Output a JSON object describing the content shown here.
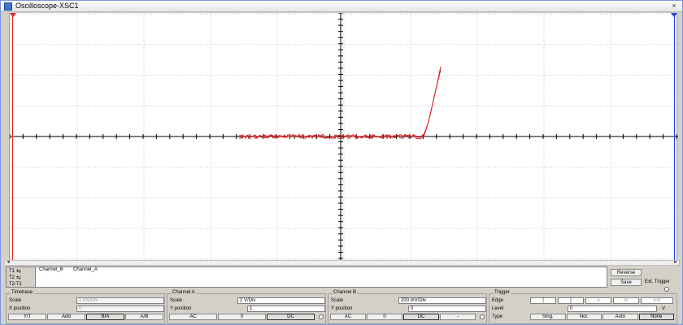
{
  "window": {
    "title": "Oscilloscope-XSC1",
    "close_glyph": "×"
  },
  "scope": {
    "grid": true,
    "trace_color": "#e02020",
    "cursor1_color": "#e02020",
    "cursor2_color": "#2040e0"
  },
  "readout": {
    "t1": "T1",
    "t2": "T2",
    "t2t1": "T2-T1",
    "arrow_glyph": "⇆",
    "col_channel_b": "Channel_B",
    "col_channel_a": "Channel_A",
    "reverse_label": "Reverse",
    "save_label": "Save",
    "ext_trigger_label": "Ext. Trigger"
  },
  "timebase": {
    "title": "Timebase",
    "scale_label": "Scale",
    "scale_value": "1 ms/Div",
    "xpos_label": "X position",
    "xpos_value": "0",
    "modes": [
      "Y/T",
      "Add",
      "B/A",
      "A/B"
    ],
    "active_mode": "B/A"
  },
  "channel_a": {
    "title": "Channel A",
    "scale_label": "Scale",
    "scale_value": "2  V/Div",
    "ypos_label": "Y position",
    "ypos_value": "1",
    "coupling": [
      "AC",
      "0",
      "DC"
    ],
    "active_coupling": "DC"
  },
  "channel_b": {
    "title": "Channel B",
    "scale_label": "Scale",
    "scale_value": "200 mV/Div",
    "ypos_label": "Y position",
    "ypos_value": "0",
    "coupling": [
      "AC",
      "0",
      "DC",
      "-"
    ],
    "active_coupling": "DC"
  },
  "trigger": {
    "title": "Trigger",
    "edge_label": "Edge",
    "edge_options": [
      "rising-edge-icon",
      "falling-edge-icon",
      "A",
      "B",
      "Ext"
    ],
    "level_label": "Level",
    "level_value": "0",
    "level_unit": "V",
    "type_label": "Type",
    "types": [
      "Sing.",
      "Nor.",
      "Auto",
      "None"
    ],
    "active_type": "None"
  }
}
